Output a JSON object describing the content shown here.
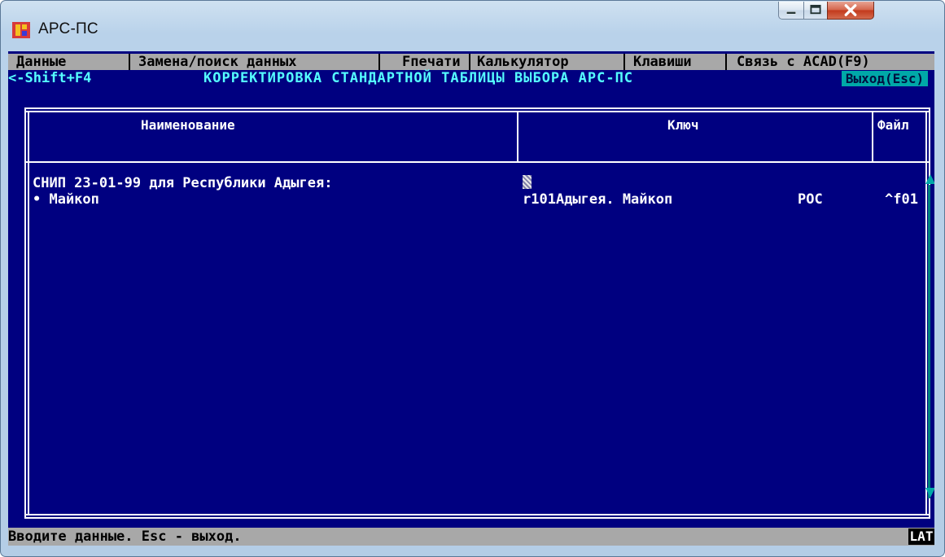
{
  "window": {
    "title": "АРС-ПС"
  },
  "menu": {
    "items": [
      {
        "label": "Данные"
      },
      {
        "label": "Замена/поиск данных"
      },
      {
        "label": "Fпечати"
      },
      {
        "label": "Калькулятор"
      },
      {
        "label": "Клавиши"
      },
      {
        "label": "Связь с ACAD(F9)"
      }
    ]
  },
  "header": {
    "shift_hint": "<-Shift+F4",
    "screen_title": "КОРРЕКТИРОВКА СТАНДАРТНОЙ ТАБЛИЦЫ ВЫБОРА АРС-ПС",
    "exit_label": "Выход(Esc)"
  },
  "table": {
    "columns": [
      {
        "label": "Наименование"
      },
      {
        "label": "Ключ"
      },
      {
        "label": "Файл"
      }
    ],
    "group_heading": "СНИП 23-01-99 для Республики Адыгея:",
    "rows": [
      {
        "name": "• Майкоп",
        "key": "r101Адыгея. Майкоп",
        "code": "РОС",
        "file": "^f01"
      }
    ]
  },
  "status": {
    "message": "Вводите данные. Esc - выход.",
    "keyboard_layout": "LAT"
  },
  "colors": {
    "console_bg": "#000080",
    "menu_bg": "#a8a8a8",
    "accent_cyan": "#55ffff",
    "exit_bg": "#00a8a8"
  }
}
